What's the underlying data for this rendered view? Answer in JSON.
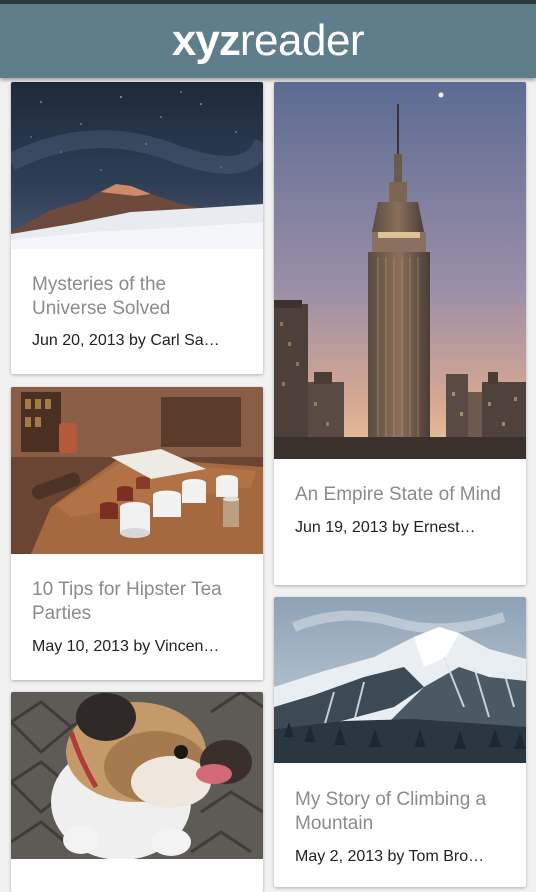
{
  "app": {
    "logo_bold": "xyz",
    "logo_light": "reader"
  },
  "articles": [
    {
      "title": "Mysteries of the Universe Solved",
      "subtitle": "Jun 20, 2013 by Carl Sa…",
      "image": "night-sky-mountain"
    },
    {
      "title": "An Empire State of Mind",
      "subtitle": "Jun 19, 2013 by Ernest…",
      "image": "empire-state-building"
    },
    {
      "title": "10 Tips for Hipster Tea Parties",
      "subtitle": "May 10, 2013 by Vincen…",
      "image": "tea-cups-table"
    },
    {
      "title": "My Story of Climbing a Mountain",
      "subtitle": "May 2, 2013 by Tom Bro…",
      "image": "snowy-mountain"
    },
    {
      "title": "",
      "subtitle": "",
      "image": "bulldog"
    }
  ]
}
